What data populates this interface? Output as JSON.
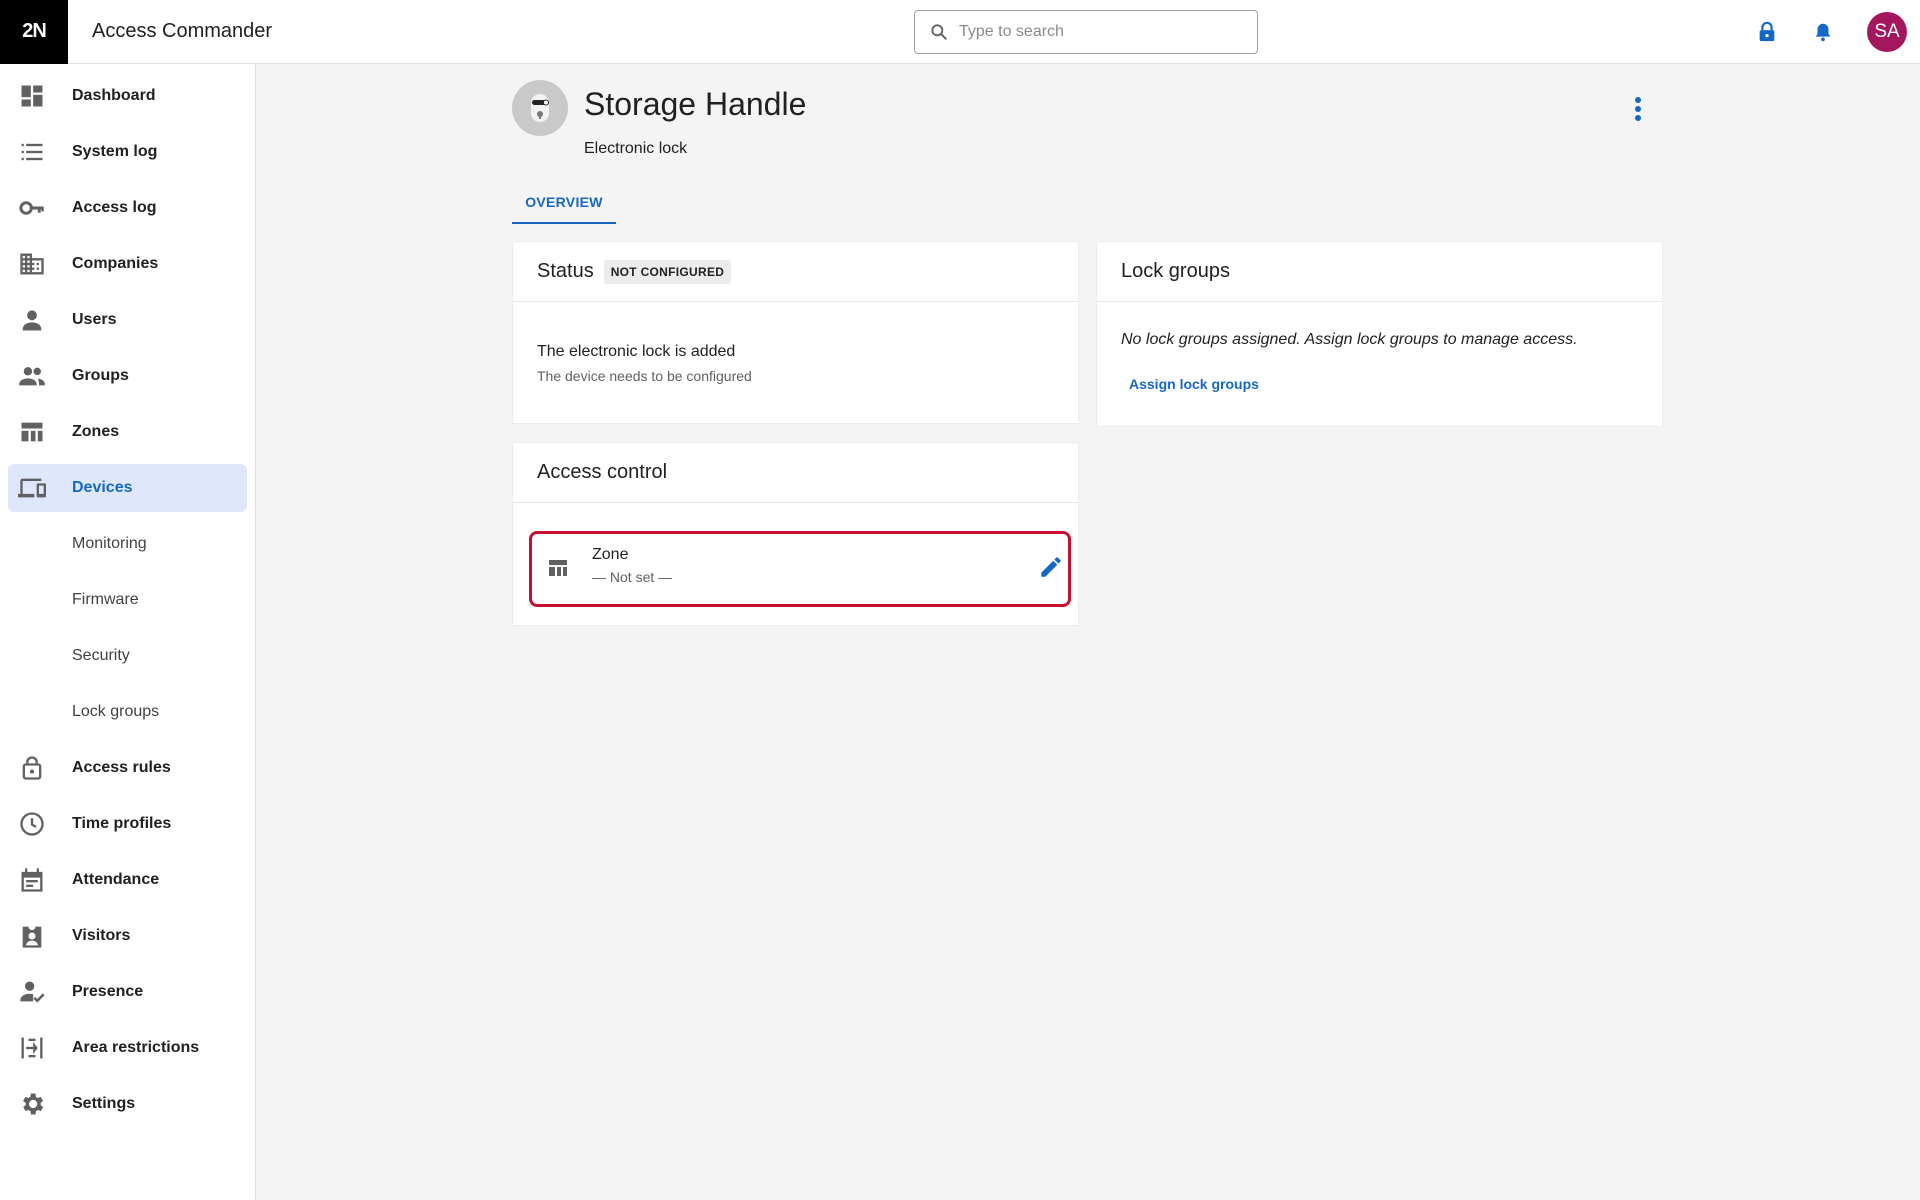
{
  "app": {
    "logo": "2N",
    "title": "Access Commander"
  },
  "search": {
    "placeholder": "Type to search"
  },
  "header": {
    "avatar_initials": "SA",
    "avatar_color": "#a4175f",
    "icons": [
      "lock-icon",
      "bell-icon"
    ]
  },
  "sidebar": {
    "items": [
      {
        "label": "Dashboard",
        "icon": "dashboard-icon"
      },
      {
        "label": "System log",
        "icon": "list-icon"
      },
      {
        "label": "Access log",
        "icon": "key-icon"
      },
      {
        "label": "Companies",
        "icon": "building-icon"
      },
      {
        "label": "Users",
        "icon": "person-icon"
      },
      {
        "label": "Groups",
        "icon": "people-icon"
      },
      {
        "label": "Zones",
        "icon": "zones-icon"
      },
      {
        "label": "Devices",
        "icon": "devices-icon",
        "active": true
      },
      {
        "label": "Monitoring"
      },
      {
        "label": "Firmware"
      },
      {
        "label": "Security"
      },
      {
        "label": "Lock groups"
      },
      {
        "label": "Access rules",
        "icon": "lock-outline-icon"
      },
      {
        "label": "Time profiles",
        "icon": "clock-icon"
      },
      {
        "label": "Attendance",
        "icon": "calendar-icon"
      },
      {
        "label": "Visitors",
        "icon": "badge-icon"
      },
      {
        "label": "Presence",
        "icon": "person-check-icon"
      },
      {
        "label": "Area restrictions",
        "icon": "area-icon"
      },
      {
        "label": "Settings",
        "icon": "gear-icon"
      }
    ]
  },
  "device": {
    "name": "Storage Handle",
    "type": "Electronic lock"
  },
  "tabs": [
    {
      "label": "OVERVIEW",
      "active": true
    }
  ],
  "status_card": {
    "title": "Status",
    "badge": "NOT CONFIGURED",
    "message": "The electronic lock is added",
    "detail": "The device needs to be configured"
  },
  "lock_groups_card": {
    "title": "Lock groups",
    "empty_text": "No lock groups assigned. Assign lock groups to manage access.",
    "assign_link": "Assign lock groups"
  },
  "access_control_card": {
    "title": "Access control",
    "zone_label": "Zone",
    "zone_value": "— Not set —"
  },
  "colors": {
    "accent": "#1668c4",
    "active_bg": "#dfe7fd",
    "highlight": "#c8102e"
  }
}
